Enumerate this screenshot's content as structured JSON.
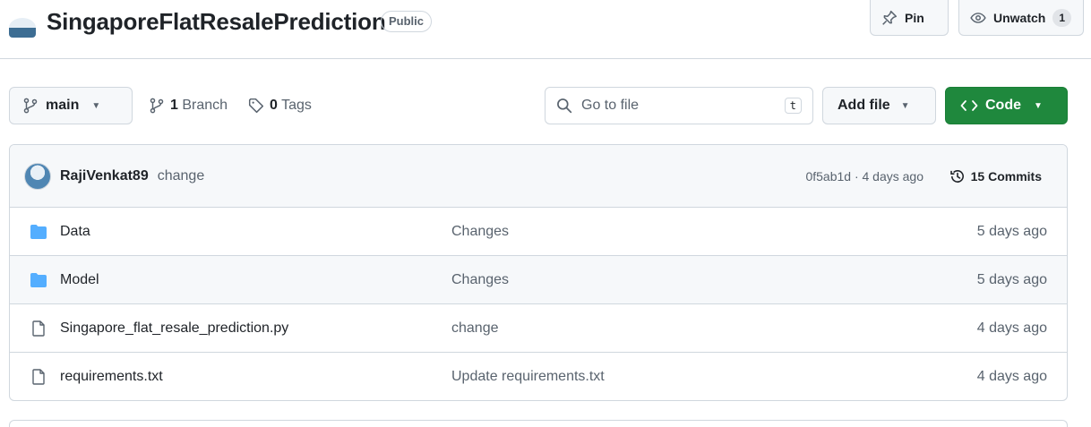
{
  "repo": {
    "name": "SingaporeFlatResalePrediction",
    "visibility": "Public",
    "pin_label": "Pin",
    "watch_label": "Unwatch",
    "watch_count": "1"
  },
  "toolbar": {
    "branch": "main",
    "branches_count": "1",
    "branches_label": "Branch",
    "tags_count": "0",
    "tags_label": "Tags",
    "search_placeholder": "Go to file",
    "search_shortcut": "t",
    "add_file_label": "Add file",
    "code_label": "Code"
  },
  "latest_commit": {
    "author": "RajiVenkat89",
    "message": "change",
    "meta": "0f5ab1d · 4 days ago",
    "commits_label": "15 Commits"
  },
  "files": [
    {
      "type": "folder",
      "name": "Data",
      "commit": "Changes",
      "age": "5 days ago"
    },
    {
      "type": "folder",
      "name": "Model",
      "commit": "Changes",
      "age": "5 days ago"
    },
    {
      "type": "file",
      "name": "Singapore_flat_resale_prediction.py",
      "commit": "change",
      "age": "4 days ago"
    },
    {
      "type": "file",
      "name": "requirements.txt",
      "commit": "Update requirements.txt",
      "age": "4 days ago"
    }
  ],
  "colors": {
    "accent_green": "#1f883d",
    "folder_blue": "#54aeff",
    "border": "#d0d7de",
    "muted_text": "#59636e"
  }
}
